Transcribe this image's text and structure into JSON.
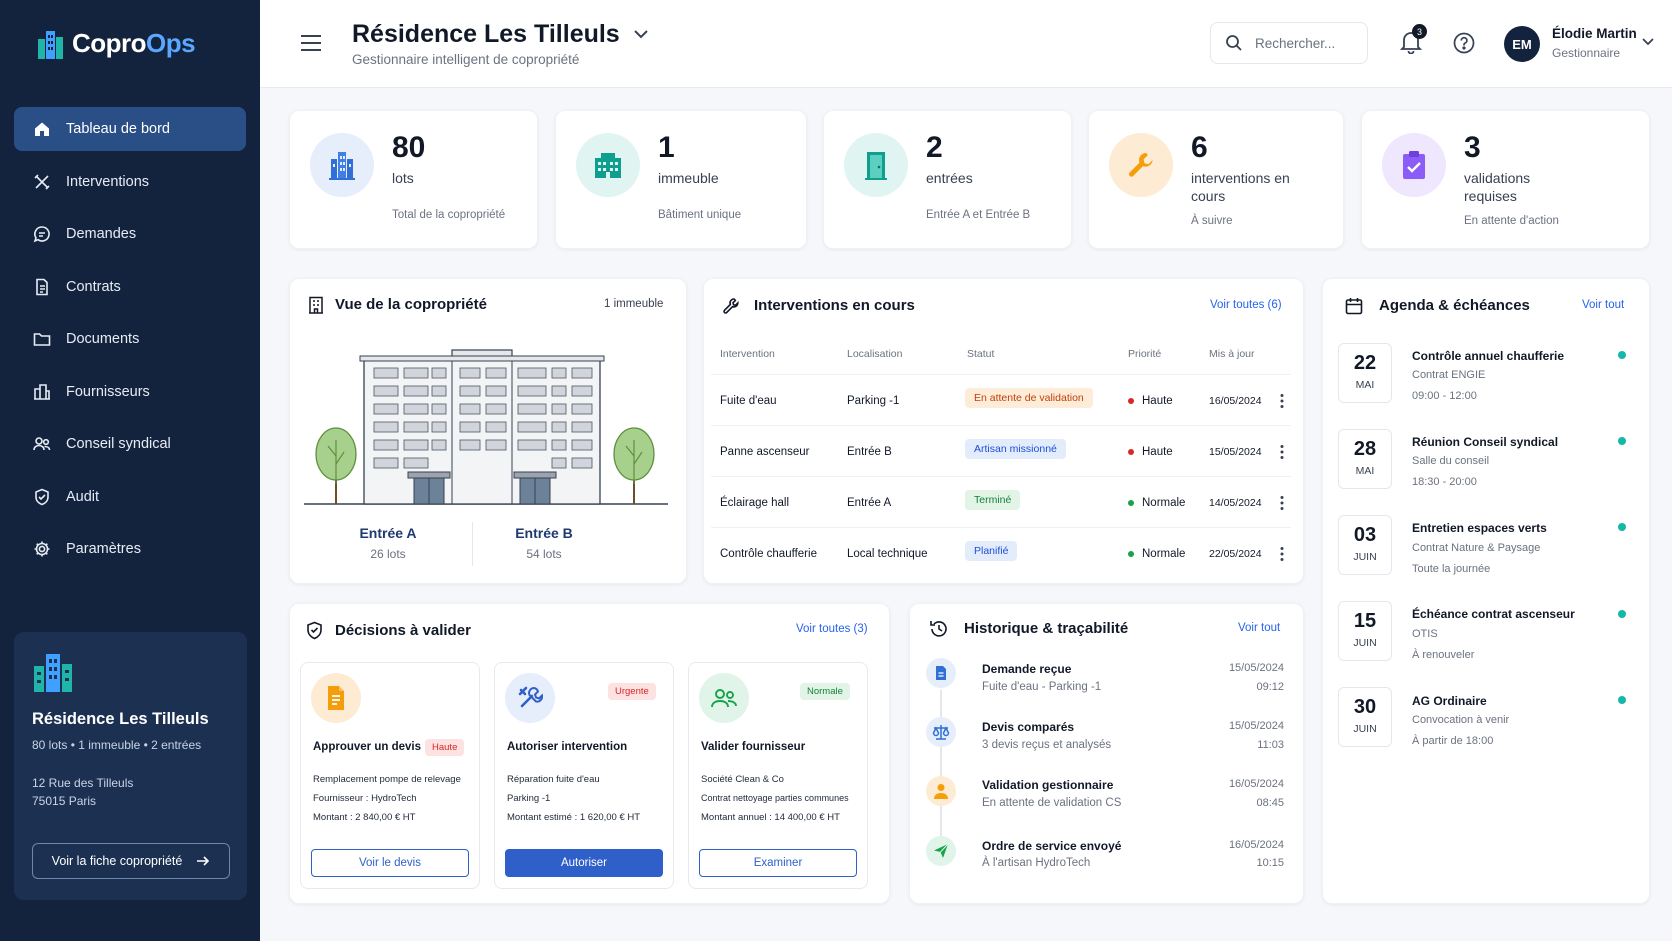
{
  "app": {
    "name_part1": "Copro",
    "name_part2": "Ops"
  },
  "sidebar": {
    "items": [
      {
        "label": "Tableau de bord",
        "icon": "home-icon"
      },
      {
        "label": "Interventions",
        "icon": "tools-icon"
      },
      {
        "label": "Demandes",
        "icon": "chat-icon"
      },
      {
        "label": "Contrats",
        "icon": "document-icon"
      },
      {
        "label": "Documents",
        "icon": "folder-icon"
      },
      {
        "label": "Fournisseurs",
        "icon": "building-icon"
      },
      {
        "label": "Conseil syndical",
        "icon": "users-icon"
      },
      {
        "label": "Audit",
        "icon": "shield-icon"
      },
      {
        "label": "Paramètres",
        "icon": "gear-icon"
      }
    ],
    "card": {
      "title": "Résidence Les Tilleuls",
      "summary": "80 lots  •  1 immeuble  •  2 entrées",
      "address_line1": "12 Rue des Tilleuls",
      "address_line2": "75015 Paris",
      "button": "Voir la fiche copropriété"
    }
  },
  "header": {
    "title": "Résidence Les Tilleuls",
    "subtitle": "Gestionnaire intelligent de copropriété",
    "search_placeholder": "Rechercher...",
    "notifications": "3",
    "user": {
      "initials": "EM",
      "name": "Élodie Martin",
      "role": "Gestionnaire"
    }
  },
  "stats": [
    {
      "number": "80",
      "label": "lots",
      "caption": "Total de la copropriété",
      "color": "#2f6fd6"
    },
    {
      "number": "1",
      "label": "immeuble",
      "caption": "Bâtiment unique",
      "color": "#0f9f8f"
    },
    {
      "number": "2",
      "label": "entrées",
      "caption": "Entrée A et Entrée B",
      "color": "#0f9f8f"
    },
    {
      "number": "6",
      "label": "interventions en cours",
      "caption": "À suivre",
      "color": "#f59e0b"
    },
    {
      "number": "3",
      "label": "validations requises",
      "caption": "En attente d'action",
      "color": "#8b5cf6"
    }
  ],
  "overview": {
    "title": "Vue de la copropriété",
    "meta": "1 immeuble",
    "entrances": [
      {
        "name": "Entrée A",
        "lots": "26 lots"
      },
      {
        "name": "Entrée B",
        "lots": "54 lots"
      }
    ]
  },
  "interventions": {
    "title": "Interventions en cours",
    "link": "Voir toutes (6)",
    "headers": [
      "Intervention",
      "Localisation",
      "Statut",
      "Priorité",
      "Mis à jour"
    ],
    "rows": [
      {
        "name": "Fuite d'eau",
        "location": "Parking -1",
        "status": "En attente de validation",
        "status_color": "#c2410c",
        "status_bg": "#fdecd8",
        "priority": "Haute",
        "priority_color": "#dc2626",
        "date": "16/05/2024"
      },
      {
        "name": "Panne ascenseur",
        "location": "Entrée B",
        "status": "Artisan missionné",
        "status_color": "#1d4ed8",
        "status_bg": "#e3ecfb",
        "priority": "Haute",
        "priority_color": "#dc2626",
        "date": "15/05/2024"
      },
      {
        "name": "Éclairage hall",
        "location": "Entrée A",
        "status": "Terminé",
        "status_color": "#15803d",
        "status_bg": "#e1f4e6",
        "priority": "Normale",
        "priority_color": "#16a34a",
        "date": "14/05/2024"
      },
      {
        "name": "Contrôle chaufferie",
        "location": "Local technique",
        "status": "Planifié",
        "status_color": "#1d4ed8",
        "status_bg": "#e3ecfb",
        "priority": "Normale",
        "priority_color": "#16a34a",
        "date": "22/05/2024"
      }
    ]
  },
  "agenda": {
    "title": "Agenda & échéances",
    "link": "Voir tout",
    "items": [
      {
        "day": "22",
        "month": "MAI",
        "title": "Contrôle annuel chaufferie",
        "sub": "Contrat ENGIE",
        "time": "09:00 - 12:00"
      },
      {
        "day": "28",
        "month": "MAI",
        "title": "Réunion Conseil syndical",
        "sub": "Salle du conseil",
        "time": "18:30 - 20:00"
      },
      {
        "day": "03",
        "month": "JUIN",
        "title": "Entretien espaces verts",
        "sub": "Contrat Nature & Paysage",
        "time": "Toute la journée"
      },
      {
        "day": "15",
        "month": "JUIN",
        "title": "Échéance contrat ascenseur",
        "sub": "OTIS",
        "time": "À renouveler"
      },
      {
        "day": "30",
        "month": "JUIN",
        "title": "AG Ordinaire",
        "sub": "Convocation à venir",
        "time": "À partir de 18:00"
      }
    ]
  },
  "decisions": {
    "title": "Décisions à valider",
    "link": "Voir toutes (3)",
    "cards": [
      {
        "title": "Approuver un devis",
        "tag": "Haute",
        "line1": "Remplacement pompe de relevage",
        "line2": "Fournisseur : HydroTech",
        "line3": "Montant : 2 840,00 € HT",
        "button": "Voir le devis"
      },
      {
        "title": "Autoriser intervention",
        "tag": "Urgente",
        "line1": "Réparation fuite d'eau",
        "line2": "Parking -1",
        "line3": "Montant estimé : 1 620,00 € HT",
        "button": "Autoriser"
      },
      {
        "title": "Valider fournisseur",
        "tag": "Normale",
        "line1": "Société Clean & Co",
        "line2": "Contrat nettoyage parties communes",
        "line3": "Montant annuel : 14 400,00 € HT",
        "button": "Examiner"
      }
    ]
  },
  "history": {
    "title": "Historique & traçabilité",
    "link": "Voir tout",
    "items": [
      {
        "title": "Demande reçue",
        "sub": "Fuite d'eau - Parking -1",
        "date": "15/05/2024",
        "time": "09:12"
      },
      {
        "title": "Devis comparés",
        "sub": "3 devis reçus et analysés",
        "date": "15/05/2024",
        "time": "11:03"
      },
      {
        "title": "Validation gestionnaire",
        "sub": "En attente de validation CS",
        "date": "16/05/2024",
        "time": "08:45"
      },
      {
        "title": "Ordre de service envoyé",
        "sub": "À l'artisan HydroTech",
        "date": "16/05/2024",
        "time": "10:15"
      }
    ]
  }
}
